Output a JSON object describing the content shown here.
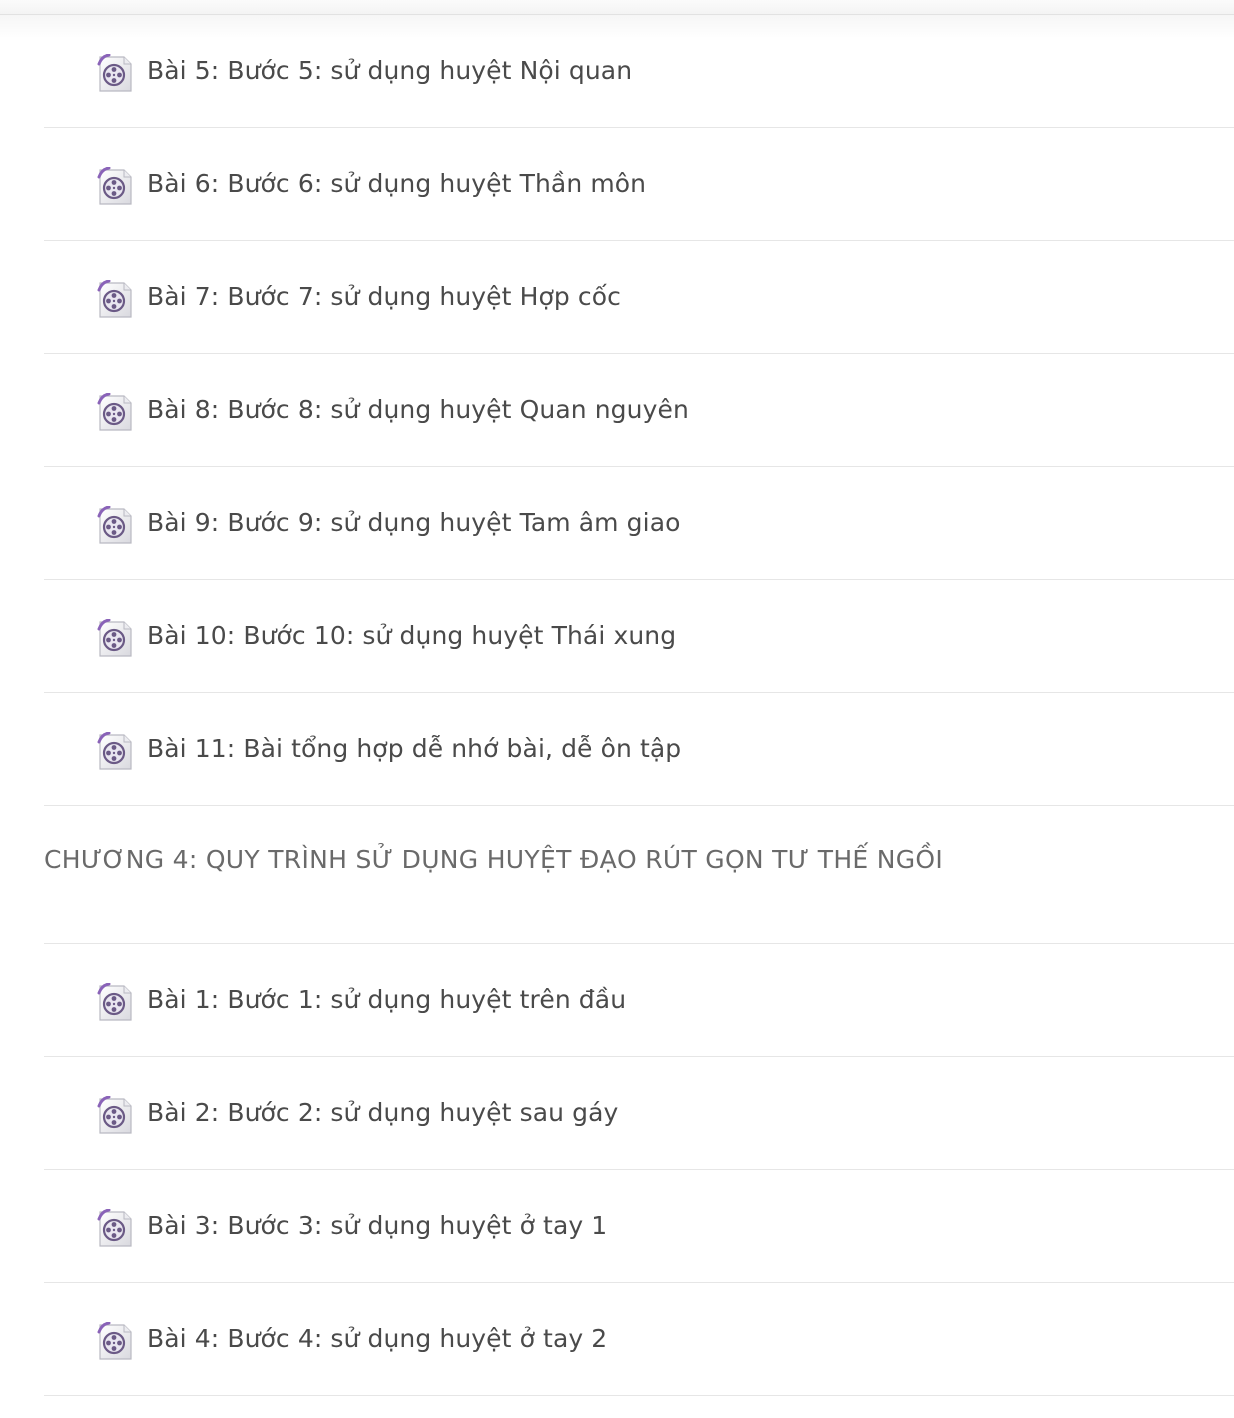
{
  "lessons_top": [
    {
      "title": "Bài 5: Bước 5: sử dụng huyệt Nội quan",
      "icon": "video-file-icon"
    },
    {
      "title": "Bài 6: Bước 6: sử dụng huyệt Thần môn",
      "icon": "video-file-icon"
    },
    {
      "title": "Bài 7: Bước 7: sử dụng huyệt Hợp cốc",
      "icon": "video-file-icon"
    },
    {
      "title": "Bài 8: Bước 8: sử dụng huyệt Quan nguyên",
      "icon": "video-file-icon"
    },
    {
      "title": "Bài 9: Bước 9: sử dụng huyệt Tam âm giao",
      "icon": "video-file-icon"
    },
    {
      "title": "Bài 10: Bước 10: sử dụng huyệt Thái xung",
      "icon": "video-file-icon"
    },
    {
      "title": "Bài 11: Bài tổng hợp dễ nhớ bài, dễ ôn tập",
      "icon": "video-file-icon"
    }
  ],
  "chapter_4": {
    "title": "CHƯƠNG 4: QUY TRÌNH SỬ DỤNG HUYỆT ĐẠO RÚT GỌN TƯ THẾ NGỒI",
    "lessons": [
      {
        "title": "Bài 1: Bước 1: sử dụng huyệt trên đầu",
        "icon": "video-file-icon"
      },
      {
        "title": "Bài 2: Bước 2: sử dụng huyệt sau gáy",
        "icon": "video-file-icon"
      },
      {
        "title": "Bài 3: Bước 3: sử dụng huyệt ở tay 1",
        "icon": "video-file-icon"
      },
      {
        "title": "Bài 4: Bước 4: sử dụng huyệt ở tay 2",
        "icon": "video-file-icon"
      }
    ]
  },
  "colors": {
    "text": "#4a4a4a",
    "chapter_text": "#6a6a6a",
    "divider": "#e6e6e6",
    "icon_accent": "#8a63b8"
  }
}
